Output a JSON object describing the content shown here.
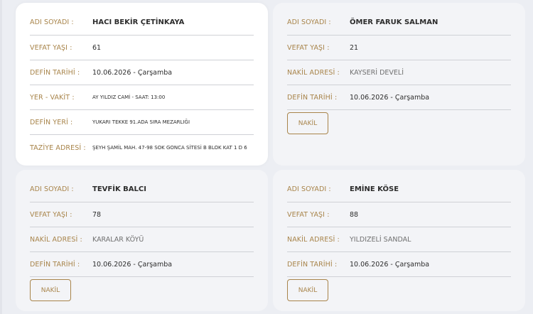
{
  "cards": [
    {
      "rows": [
        {
          "label": "ADI SOYADI :",
          "value": "HACI BEKİR ÇETİNKAYA"
        },
        {
          "label": "VEFAT YAŞI :",
          "value": "61"
        },
        {
          "label": "DEFİN TARİHİ :",
          "value": "10.06.2026 - Çarşamba"
        },
        {
          "label": "YER - VAKİT :",
          "value": "AY YILDIZ CAMİ - SAAT: 13:00"
        },
        {
          "label": "DEFİN YERİ :",
          "value": "YUKARI TEKKE 91.ADA SIRA MEZARLIĞI"
        },
        {
          "label": "TAZİYE ADRESİ :",
          "value": "ŞEYH ŞAMİL MAH. 47-98 SOK GONCA SİTESİ B BLOK KAT 1 D 6"
        }
      ]
    },
    {
      "rows": [
        {
          "label": "ADI SOYADI :",
          "value": "ÖMER FARUK SALMAN"
        },
        {
          "label": "VEFAT YAŞI :",
          "value": "21"
        },
        {
          "label": "NAKİL ADRESİ :",
          "value": "KAYSERİ DEVELİ"
        },
        {
          "label": "DEFİN TARİHİ :",
          "value": "10.06.2026 - Çarşamba"
        }
      ],
      "button": "NAKİL"
    },
    {
      "rows": [
        {
          "label": "ADI SOYADI :",
          "value": "TEVFİK BALCI"
        },
        {
          "label": "VEFAT YAŞI :",
          "value": "78"
        },
        {
          "label": "NAKİL ADRESİ :",
          "value": "KARALAR KÖYÜ"
        },
        {
          "label": "DEFİN TARİHİ :",
          "value": "10.06.2026 - Çarşamba"
        }
      ],
      "button": "NAKİL"
    },
    {
      "rows": [
        {
          "label": "ADI SOYADI :",
          "value": "EMİNE KÖSE"
        },
        {
          "label": "VEFAT YAŞI :",
          "value": "88"
        },
        {
          "label": "NAKİL ADRESİ :",
          "value": "YILDIZELİ SANDAL"
        },
        {
          "label": "DEFİN TARİHİ :",
          "value": "10.06.2026 - Çarşamba"
        }
      ],
      "button": "NAKİL"
    }
  ],
  "colors": {
    "accent": "#a8844a",
    "text": "#2c2c2c",
    "divider": "#cfd1d6"
  }
}
